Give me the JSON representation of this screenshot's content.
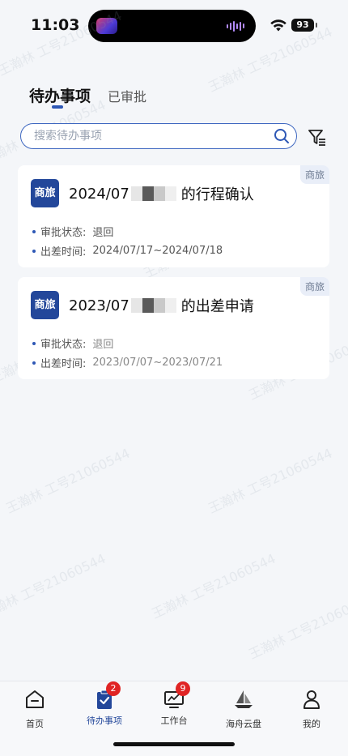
{
  "status_bar": {
    "time": "11:03",
    "battery": "93"
  },
  "tabs": [
    {
      "label": "待办事项"
    },
    {
      "label": "已审批"
    }
  ],
  "search": {
    "placeholder": "搜索待办事项"
  },
  "cards": [
    {
      "badge": "商旅",
      "logo": "商旅",
      "title_prefix": "2024/07",
      "title_suffix": "的行程确认",
      "status_label": "审批状态:",
      "status_value": "退回",
      "travel_label": "出差时间:",
      "travel_value": "2024/07/17~2024/07/18"
    },
    {
      "badge": "商旅",
      "logo": "商旅",
      "title_prefix": "2023/07",
      "title_suffix": "的出差申请",
      "status_label": "审批状态:",
      "status_value": "退回",
      "travel_label": "出差时间:",
      "travel_value": "2023/07/07~2023/07/21"
    }
  ],
  "watermark": "王瀚林 工号21060544",
  "nav": [
    {
      "label": "首页",
      "icon": "home-icon"
    },
    {
      "label": "待办事项",
      "icon": "clipboard-check-icon",
      "badge": "2"
    },
    {
      "label": "工作台",
      "icon": "monitor-chart-icon",
      "badge": "9"
    },
    {
      "label": "海舟云盘",
      "icon": "boat-logo-icon"
    },
    {
      "label": "我的",
      "icon": "user-icon"
    }
  ],
  "colors": {
    "accent": "#23479a",
    "badge_red": "#e02424",
    "background": "#f4f6f9"
  }
}
